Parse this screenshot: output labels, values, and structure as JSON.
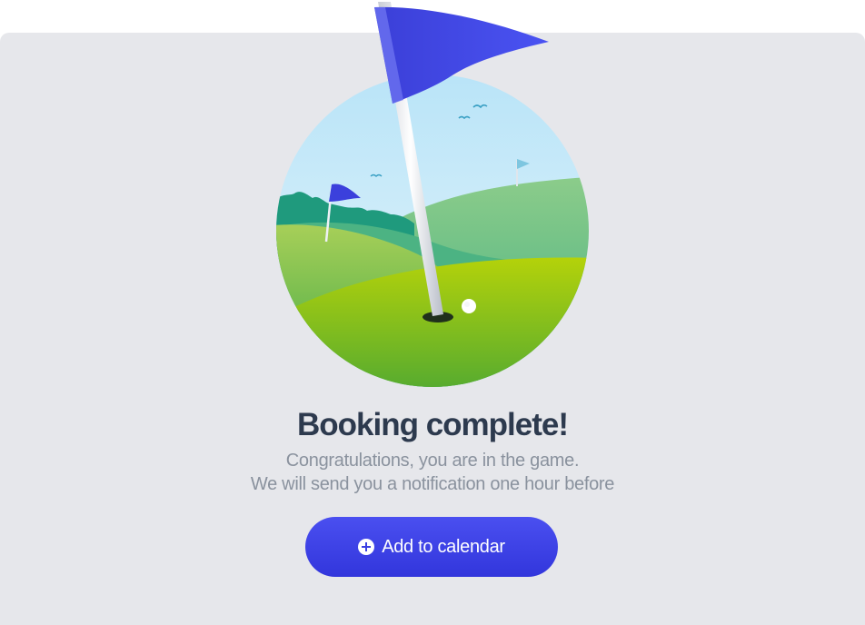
{
  "confirmation": {
    "title": "Booking complete!",
    "message_line1": "Congratulations, you are in the game.",
    "message_line2": "We will send you a notification one hour before"
  },
  "actions": {
    "add_to_calendar_label": "Add to calendar",
    "add_icon": "plus-circle-icon"
  },
  "colors": {
    "primary": "#3f44e6",
    "background": "#e6e7eb",
    "title": "#2d3a4e",
    "subtitle": "#8a929e"
  }
}
